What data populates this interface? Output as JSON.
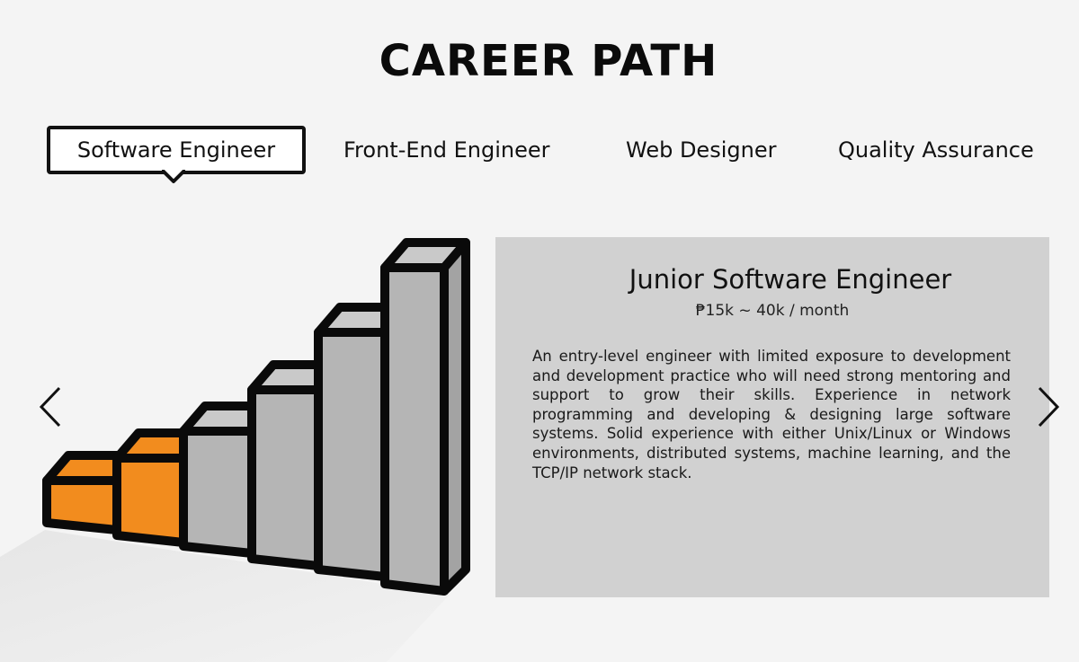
{
  "page": {
    "title": "CAREER PATH"
  },
  "tabs": [
    {
      "label": "Software Engineer",
      "active": true
    },
    {
      "label": "Front-End Engineer",
      "active": false
    },
    {
      "label": "Web Designer",
      "active": false
    },
    {
      "label": "Quality Assurance",
      "active": false
    }
  ],
  "card": {
    "title": "Junior Software Engineer",
    "salary": "₱15k ~ 40k / month",
    "description": "An entry-level engineer with limited exposure to development and development practice who will need strong mentoring and support to grow their skills. Experience in network programming and developing & designing large software systems. Solid experience with either Unix/Linux or Windows environments, distributed systems, machine learning, and the TCP/IP network stack."
  },
  "illustration": {
    "steps_total": 6,
    "steps_highlighted": 2,
    "highlight_color": "#f28c1e",
    "step_color": "#b5b5b5",
    "outline_color": "#0a0a0a"
  },
  "icons": {
    "prev": "chevron-left-icon",
    "next": "chevron-right-icon"
  },
  "colors": {
    "background": "#f4f4f4",
    "card_background": "#d1d1d1",
    "text": "#111111"
  }
}
